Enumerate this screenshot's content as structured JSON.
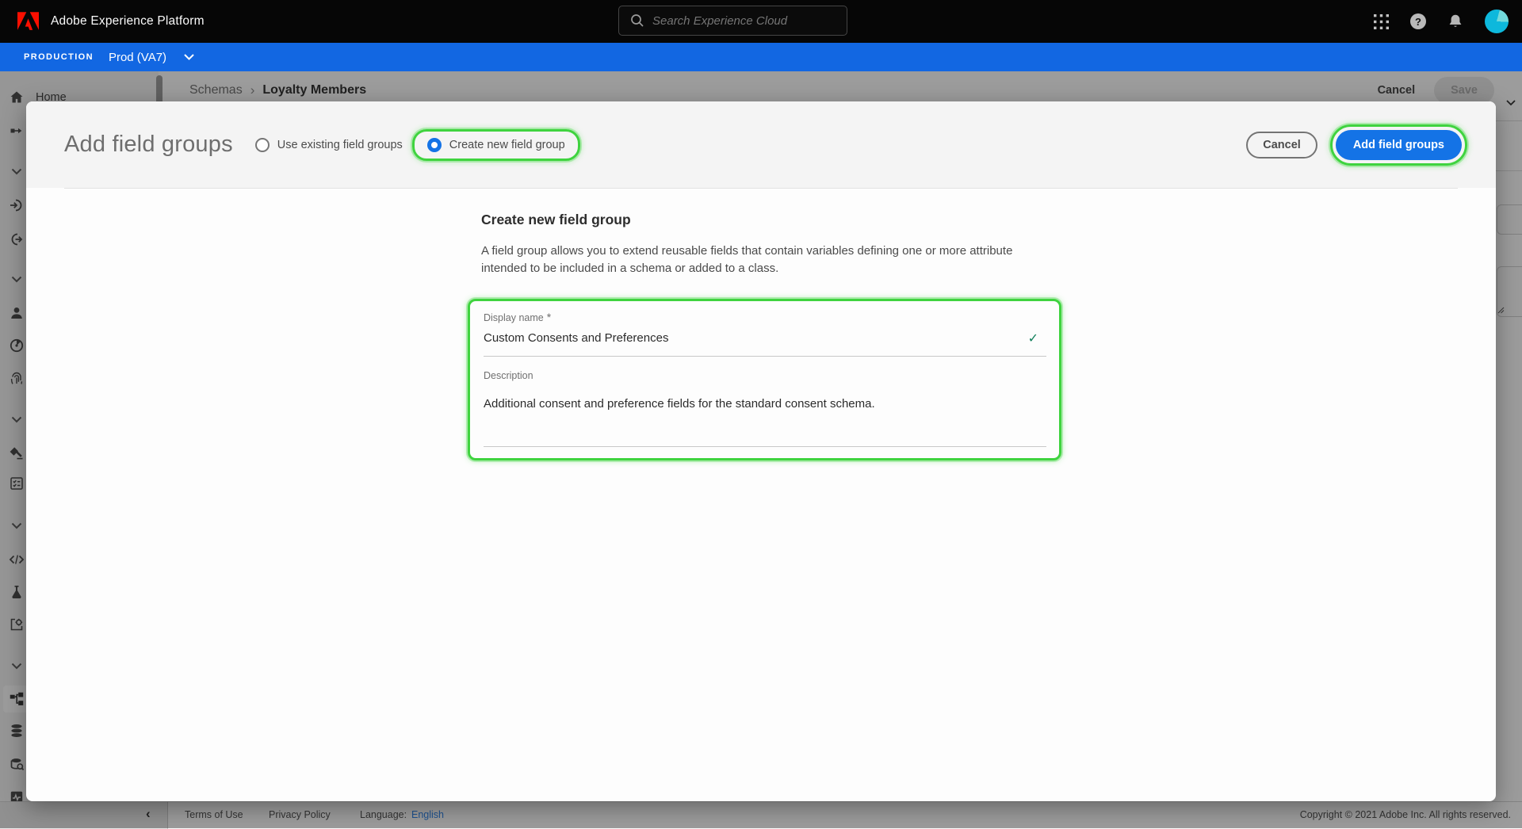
{
  "header": {
    "app_title": "Adobe Experience Platform",
    "search": {
      "placeholder": "Search Experience Cloud",
      "icon": "magnifier"
    },
    "icons": [
      "app-switcher-grid",
      "help",
      "notifications-bell",
      "user-avatar"
    ],
    "help_glyph": "?"
  },
  "env_bar": {
    "label": "PRODUCTION",
    "environment": "Prod (VA7)",
    "icon": "chevron-down"
  },
  "page": {
    "breadcrumb": {
      "parent": "Schemas",
      "separator": "›",
      "current": "Loyalty Members"
    },
    "actions": {
      "cancel": "Cancel",
      "save": "Save"
    },
    "sidebar": {
      "home_label": "Home",
      "collapse_icon": "‹",
      "selected": "schemas",
      "icons": [
        "home",
        "workflows",
        "chevron-down",
        "sources",
        "destinations",
        "chevron-down",
        "profiles",
        "audiences",
        "identities",
        "chevron-down",
        "policies",
        "requests",
        "chevron-down",
        "notebooks-code",
        "sandboxes-flask",
        "configurations-gear",
        "chevron-down",
        "schemas",
        "datasets",
        "queries",
        "monitoring"
      ]
    },
    "footer": {
      "terms": "Terms of Use",
      "privacy": "Privacy Policy",
      "language_label": "Language:",
      "language_value": "English",
      "copyright": "Copyright © 2021 Adobe Inc. All rights reserved."
    }
  },
  "modal": {
    "title": "Add field groups",
    "radios": [
      {
        "label": "Use existing field groups",
        "selected": false
      },
      {
        "label": "Create new field group",
        "selected": true
      }
    ],
    "cancel_label": "Cancel",
    "submit_label": "Add field groups",
    "content": {
      "heading": "Create new field group",
      "intro": "A field group allows you to extend reusable fields that contain variables defining one or more attribute intended to be included in a schema or added to a class.",
      "fields": [
        {
          "label": "Display name",
          "required": "*",
          "value": "Custom Consents and Preferences",
          "valid_icon": "✓"
        },
        {
          "label": "Description",
          "value": "Additional consent and preference fields for the standard consent schema."
        }
      ]
    }
  },
  "colors": {
    "accent_blue": "#1473e6",
    "env_bar_blue": "#1267e2",
    "annotation_green": "#3fd33f",
    "valid_green": "#12805c",
    "shell_black": "#060606"
  }
}
